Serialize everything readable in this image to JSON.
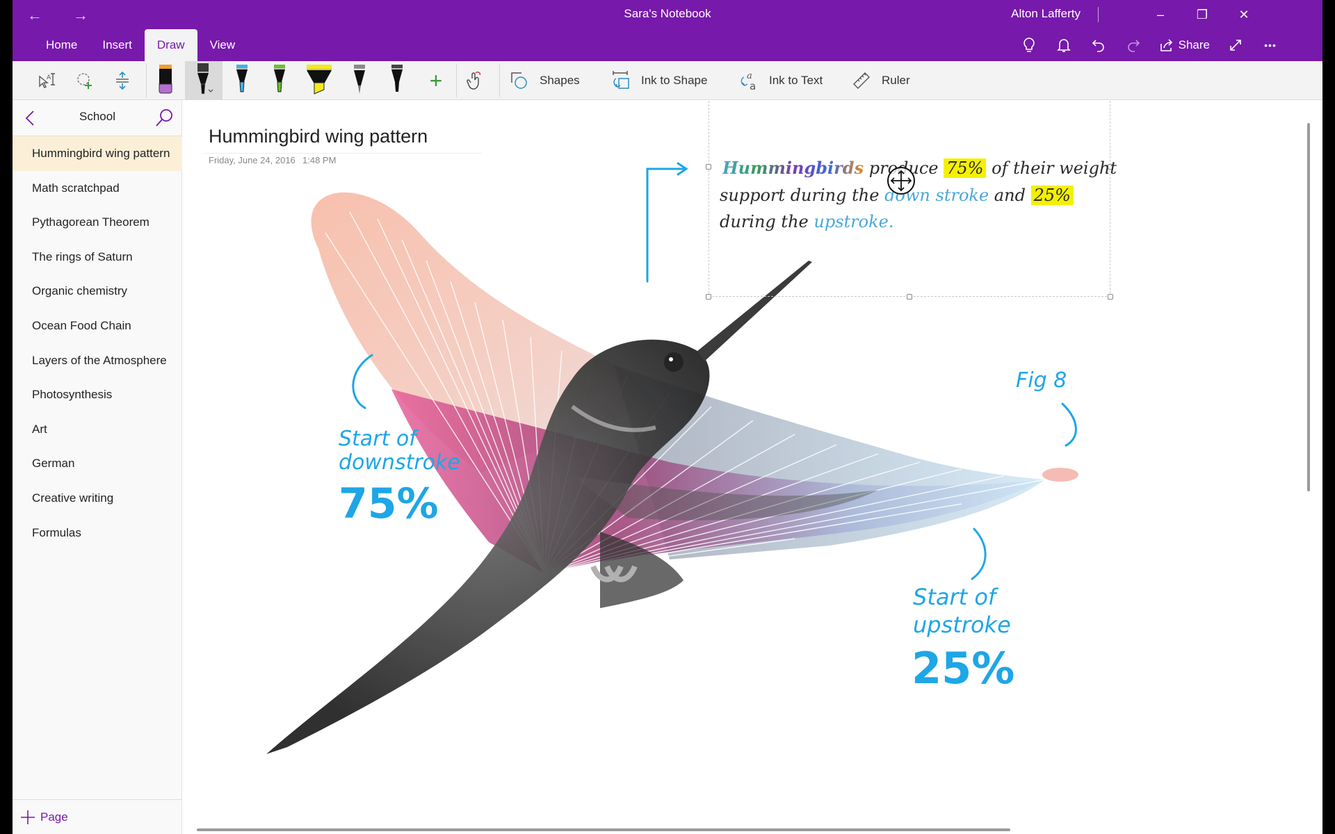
{
  "window": {
    "title": "Sara's Notebook",
    "user": "Alton Lafferty",
    "controls": {
      "minimize": "–",
      "maximize": "❐",
      "close": "✕"
    },
    "nav": {
      "back": "←",
      "forward": "→"
    }
  },
  "tabs": [
    {
      "label": "Home",
      "active": false
    },
    {
      "label": "Insert",
      "active": false
    },
    {
      "label": "Draw",
      "active": true
    },
    {
      "label": "View",
      "active": false
    }
  ],
  "top_actions": {
    "share_label": "Share",
    "more": "•••"
  },
  "ribbon": {
    "tools": [
      "type-select",
      "lasso-select",
      "insert-space"
    ],
    "pens": [
      {
        "name": "eraser",
        "color": "#b46fd0",
        "cap": "#f0a030"
      },
      {
        "name": "pen-black",
        "color": "#222222",
        "selected": true
      },
      {
        "name": "pen-blue",
        "color": "#3bb4e8"
      },
      {
        "name": "pen-green",
        "color": "#6cc02a"
      },
      {
        "name": "highlighter-yellow",
        "color": "#f4ea1a"
      },
      {
        "name": "pencil-gray",
        "color": "#8a8a8a"
      },
      {
        "name": "pen-dark",
        "color": "#333333"
      }
    ],
    "add_pen": "+",
    "shapes_label": "Shapes",
    "ink_to_shape_label": "Ink to Shape",
    "ink_to_text_label": "Ink to Text",
    "ruler_label": "Ruler"
  },
  "sidebar": {
    "section": "School",
    "pages": [
      {
        "label": "Hummingbird wing pattern",
        "active": true
      },
      {
        "label": "Math scratchpad"
      },
      {
        "label": "Pythagorean Theorem"
      },
      {
        "label": "The rings of Saturn"
      },
      {
        "label": "Organic chemistry"
      },
      {
        "label": "Ocean Food Chain"
      },
      {
        "label": "Layers of the Atmosphere"
      },
      {
        "label": "Photosynthesis"
      },
      {
        "label": "Art"
      },
      {
        "label": "German"
      },
      {
        "label": "Creative writing"
      },
      {
        "label": "Formulas"
      }
    ],
    "add_page_label": "Page"
  },
  "page": {
    "title": "Hummingbird wing pattern",
    "date": "Friday, June 24, 2016",
    "time": "1:48 PM",
    "note": {
      "word_hummingbirds": "Hummingbirds",
      "line1_a": "produce",
      "line1_pct": "75%",
      "line1_b": "of their weight",
      "line2_a": "support during the",
      "line2_down": "down",
      "line2_stroke": "stroke",
      "line2_and": "and",
      "line2_pct": "25%",
      "line3_a": "during the",
      "line3_up": "upstroke."
    },
    "annotations": {
      "downstroke_l1": "Start of",
      "downstroke_l2": "downstroke",
      "downstroke_pct": "75%",
      "upstroke_l1": "Start of",
      "upstroke_l2": "upstroke",
      "upstroke_pct": "25%",
      "fig": "Fig 8"
    }
  },
  "colors": {
    "brand": "#7719aa",
    "ink_blue": "#1ea6e6",
    "highlight": "#f4f000",
    "active_page": "#fbefd8"
  }
}
